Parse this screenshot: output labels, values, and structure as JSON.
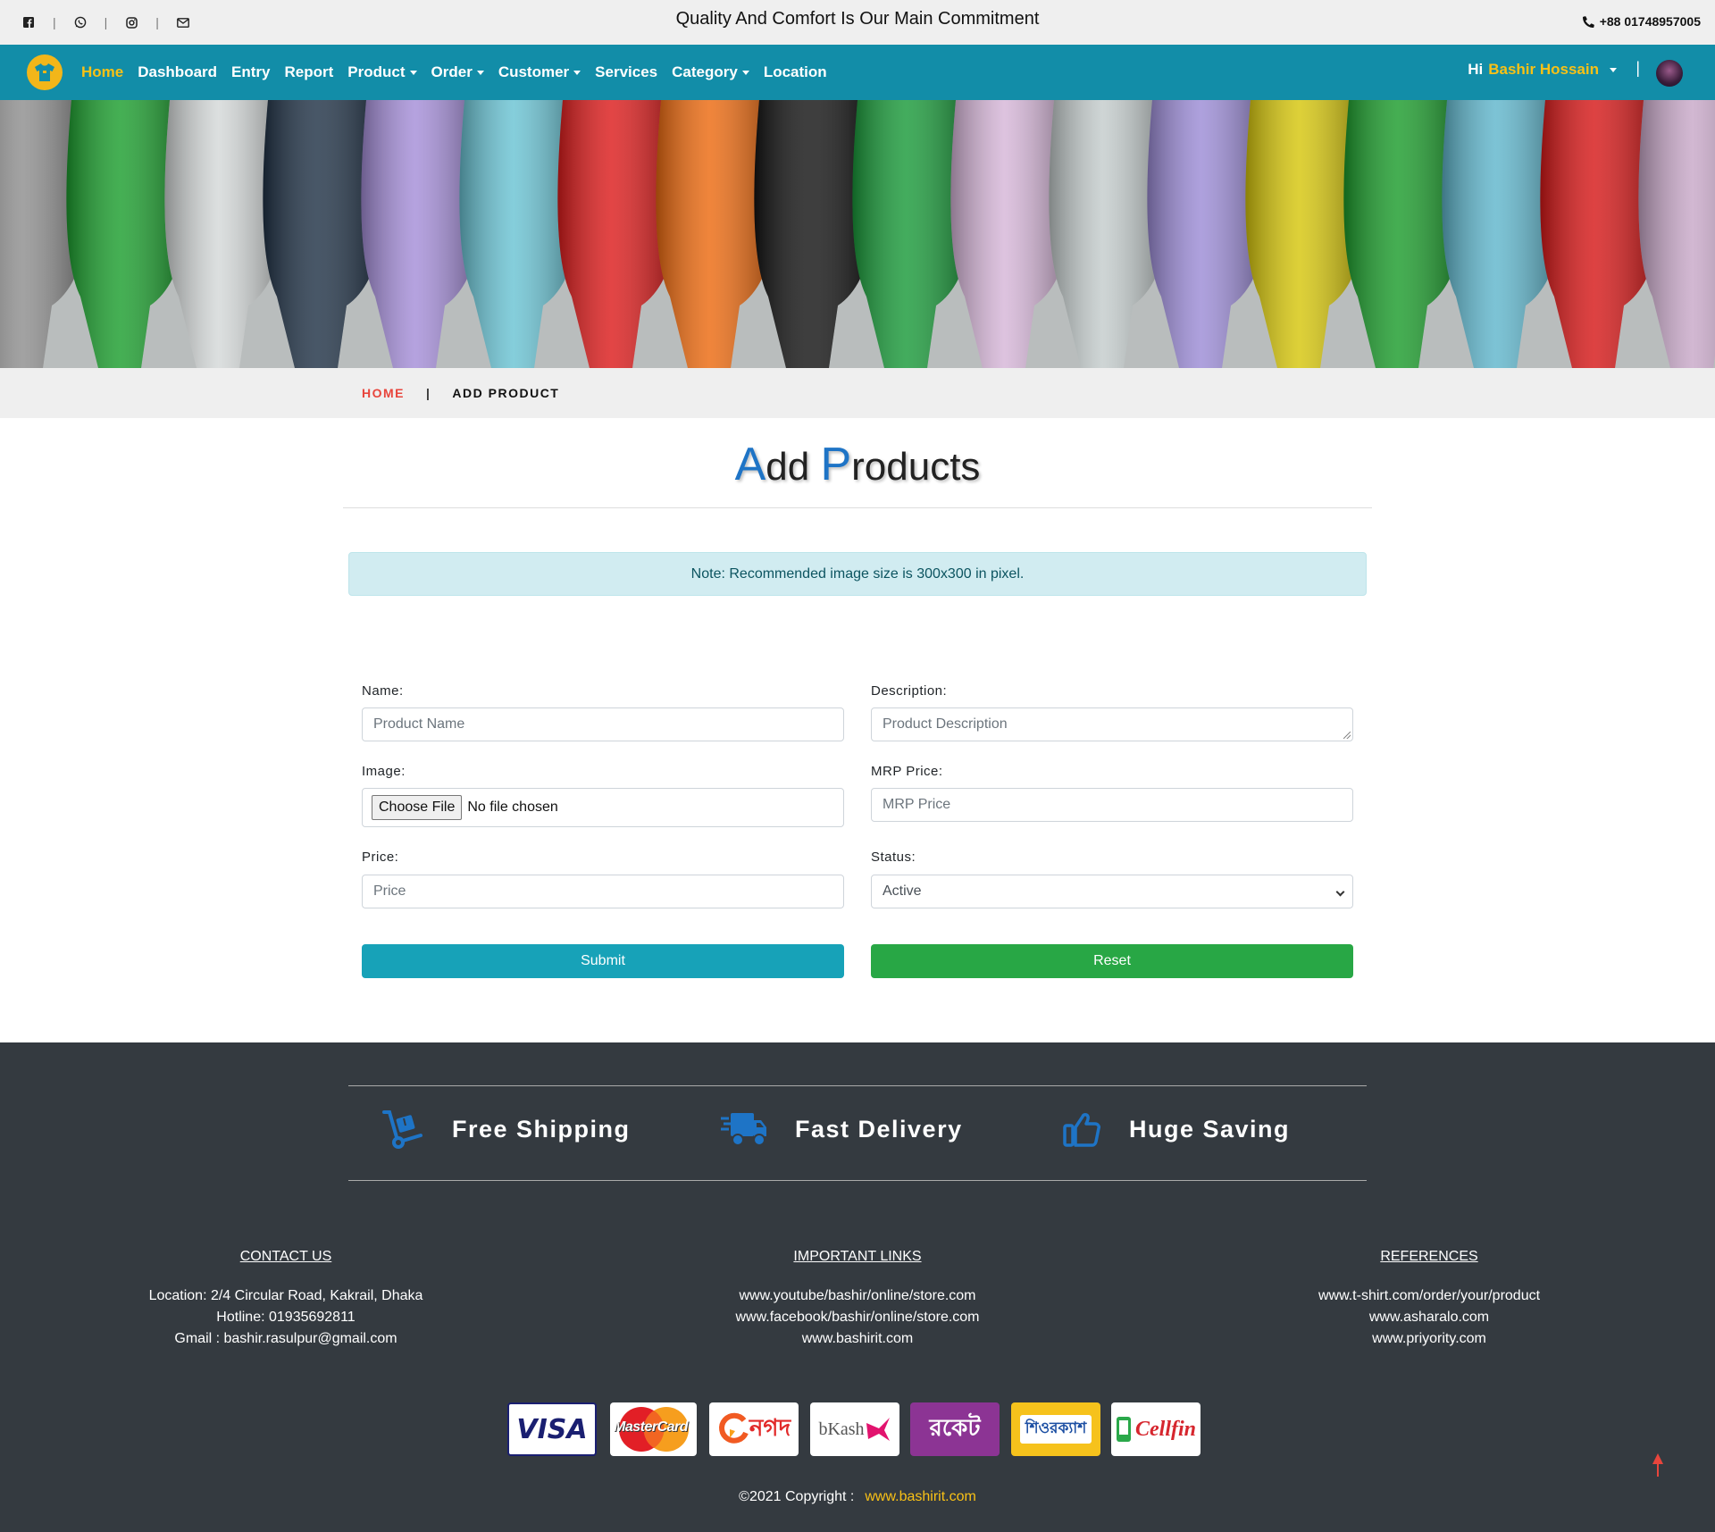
{
  "topbar": {
    "tagline": "Quality And Comfort Is Our Main Commitment",
    "phone": "+88 01748957005",
    "social_icons": [
      "facebook-icon",
      "whatsapp-icon",
      "instagram-icon",
      "envelope-icon"
    ]
  },
  "nav": {
    "items": [
      {
        "label": "Home",
        "active": true,
        "dropdown": false
      },
      {
        "label": "Dashboard",
        "dropdown": false
      },
      {
        "label": "Entry",
        "dropdown": false
      },
      {
        "label": "Report",
        "dropdown": false
      },
      {
        "label": "Product",
        "dropdown": true
      },
      {
        "label": "Order",
        "dropdown": true
      },
      {
        "label": "Customer",
        "dropdown": true
      },
      {
        "label": "Services",
        "dropdown": false
      },
      {
        "label": "Category",
        "dropdown": true
      },
      {
        "label": "Location",
        "dropdown": false
      }
    ],
    "greeting": "Hi",
    "user_name": "Bashir Hossain",
    "separator": "|"
  },
  "breadcrumb": {
    "home": "HOME",
    "separator": "|",
    "current": "ADD PRODUCT"
  },
  "heading": {
    "cap1": "A",
    "rest1": "dd ",
    "cap2": "P",
    "rest2": "roducts"
  },
  "note": "Note: Recommended image size is 300x300 in pixel.",
  "form": {
    "name_label": "Name:",
    "name_placeholder": "Product Name",
    "description_label": "Description:",
    "description_placeholder": "Product Description",
    "image_label": "Image:",
    "file_button": "Choose File",
    "file_status": "No file chosen",
    "mrp_label": "MRP Price:",
    "mrp_placeholder": "MRP Price",
    "price_label": "Price:",
    "price_placeholder": "Price",
    "status_label": "Status:",
    "status_value": "Active",
    "submit": "Submit",
    "reset": "Reset"
  },
  "features": [
    {
      "title": "Free Shipping",
      "icon": "dolly-icon"
    },
    {
      "title": "Fast Delivery",
      "icon": "truck-icon"
    },
    {
      "title": "Huge Saving",
      "icon": "thumbs-up-icon"
    }
  ],
  "footer": {
    "contact": {
      "heading": "CONTACT US",
      "lines": [
        "Location: 2/4 Circular Road, Kakrail, Dhaka",
        "Hotline: 01935692811",
        "Gmail : bashir.rasulpur@gmail.com"
      ]
    },
    "links": {
      "heading": "IMPORTANT LINKS",
      "lines": [
        "www.youtube/bashir/online/store.com",
        "www.facebook/bashir/online/store.com",
        "www.bashirit.com"
      ]
    },
    "refs": {
      "heading": "REFERENCES",
      "lines": [
        "www.t-shirt.com/order/your/product",
        "www.asharalo.com",
        "www.priyority.com"
      ]
    },
    "payments": [
      "VISA",
      "MasterCard",
      "নগদ",
      "bKash",
      "রকেট",
      "শিওরক্যাশ",
      "Cellfin"
    ],
    "copyright": "©2021 Copyright :",
    "copyright_link": "www.bashirit.com"
  },
  "colors": {
    "navbar": "#128da8",
    "accent": "#f9c116",
    "footer": "#343a40",
    "heading_cap": "#1e74c6"
  }
}
